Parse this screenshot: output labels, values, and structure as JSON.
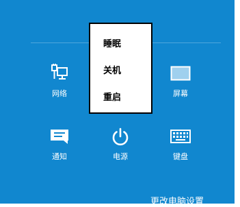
{
  "settings_charm": {
    "quick_settings": [
      {
        "label": "网络",
        "icon": "network-icon"
      },
      {
        "label": "屏幕",
        "icon": "screen-icon"
      },
      {
        "label": "通知",
        "icon": "notifications-icon"
      },
      {
        "label": "电源",
        "icon": "power-icon"
      },
      {
        "label": "键盘",
        "icon": "keyboard-icon"
      }
    ],
    "power_menu": {
      "items": [
        "睡眠",
        "关机",
        "重启"
      ]
    },
    "change_pc_settings_label": "更改电脑设置",
    "colors": {
      "charm_background": "#1187cf",
      "menu_background": "#ffffff",
      "text": "#ffffff"
    }
  }
}
